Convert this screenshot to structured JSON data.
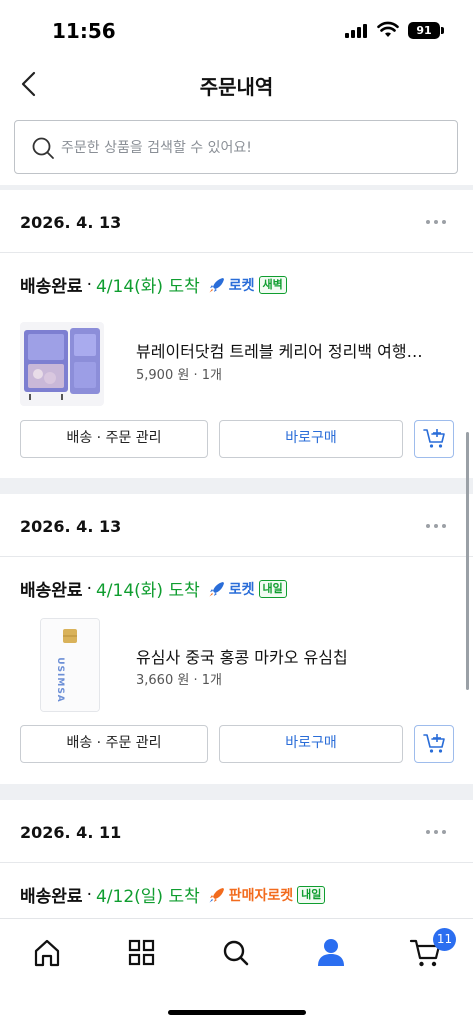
{
  "status_bar": {
    "time": "11:56",
    "battery": "91"
  },
  "header": {
    "title": "주문내역"
  },
  "search": {
    "placeholder": "주문한 상품을 검색할 수 있어요!"
  },
  "orders": [
    {
      "date": "2026. 4. 13",
      "status": "배송완료",
      "arrival": "4/14(화) 도착",
      "rocket_label": "로켓",
      "rocket_badge": "새벽",
      "product_name": "뷰레이터닷컴 트레블 케리어 정리백 여행…",
      "price": "5,900 원",
      "quantity": "1개",
      "manage_label": "배송 · 주문 관리",
      "buy_label": "바로구매"
    },
    {
      "date": "2026. 4. 13",
      "status": "배송완료",
      "arrival": "4/14(화) 도착",
      "rocket_label": "로켓",
      "rocket_badge": "내일",
      "product_name": "유심사 중국 홍콩 마카오 유심칩",
      "price": "3,660 원",
      "quantity": "1개",
      "manage_label": "배송 · 주문 관리",
      "buy_label": "바로구매",
      "sim_brand": "USIMSA"
    },
    {
      "date": "2026. 4. 11",
      "status": "배송완료",
      "arrival": "4/12(일) 도착",
      "rocket_label": "판매자로켓",
      "rocket_badge": "내일"
    }
  ],
  "tab_bar": {
    "items": [
      "home-icon",
      "category-grid-icon",
      "search-icon",
      "my-account-icon",
      "cart-icon"
    ],
    "cart_count": "11"
  },
  "colors": {
    "arrival_green": "#0f9d2f",
    "rocket_blue": "#2a6dd8",
    "seller_rocket_orange": "#f26b1d",
    "active_tab_blue": "#2b6ef0"
  }
}
